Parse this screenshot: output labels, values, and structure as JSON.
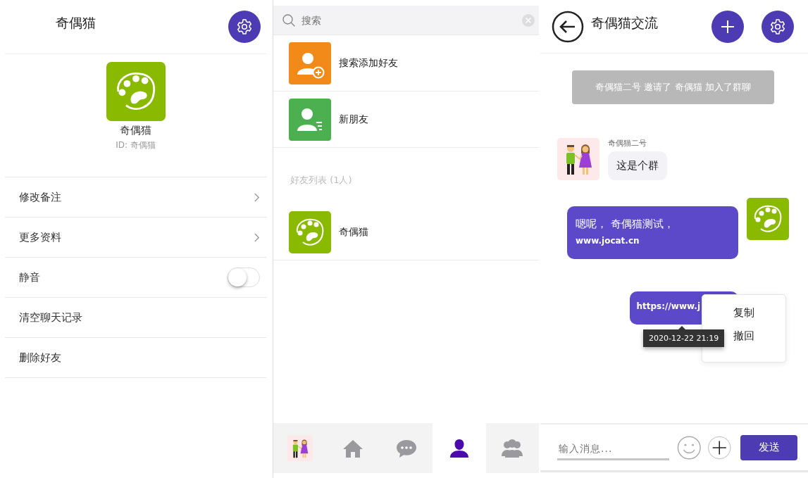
{
  "profile_panel": {
    "title": "奇偶猫",
    "name": "奇偶猫",
    "id_text": "ID: 奇偶猫",
    "menu": [
      {
        "label": "修改备注",
        "kind": "link"
      },
      {
        "label": "更多资料",
        "kind": "link"
      },
      {
        "label": "静音",
        "kind": "toggle",
        "on": false
      },
      {
        "label": "清空聊天记录",
        "kind": "plain"
      },
      {
        "label": "删除好友",
        "kind": "plain"
      }
    ]
  },
  "contacts_panel": {
    "search": {
      "placeholder": "搜索"
    },
    "entries": [
      {
        "label": "搜索添加好友",
        "kind": "add"
      },
      {
        "label": "新朋友",
        "kind": "new"
      }
    ],
    "section_title": "好友列表 (1人)",
    "friends": [
      {
        "name": "奇偶猫"
      }
    ],
    "nav": [
      {
        "kind": "couple",
        "selected": false
      },
      {
        "kind": "home",
        "selected": false
      },
      {
        "kind": "chat",
        "selected": false
      },
      {
        "kind": "contact",
        "selected": true
      },
      {
        "kind": "group",
        "selected": false
      }
    ]
  },
  "chat_panel": {
    "title": "奇偶猫交流",
    "notice": "奇偶猫二号 邀请了 奇偶猫 加入了群聊",
    "messages": [
      {
        "kind": "received",
        "sender": "奇偶猫二号",
        "text": "这是个群"
      },
      {
        "kind": "sent",
        "text": "嗯呢，  奇偶猫测试，**www.jocat.cn**"
      },
      {
        "kind": "sent",
        "text": "https://www.j"
      }
    ],
    "tooltip": "2020-12-22 21:19",
    "context_menu": [
      "复制",
      "撤回"
    ],
    "input": {
      "placeholder": "输入消息..."
    },
    "send_label": "发送"
  }
}
